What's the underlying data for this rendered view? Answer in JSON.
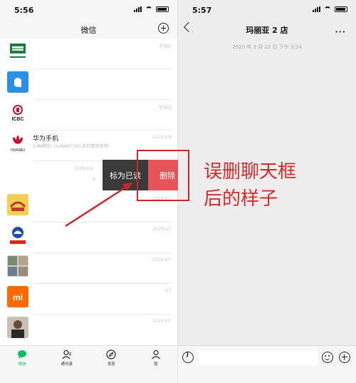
{
  "left_screen": {
    "status_time": "5:56",
    "title": "微信",
    "chats": [
      {
        "name": "",
        "preview": "",
        "date": "星期四"
      },
      {
        "name": "",
        "preview": "",
        "date": ""
      },
      {
        "name": "",
        "preview": "",
        "date": "星期四"
      },
      {
        "name": "华为手机",
        "preview": "价格揭晓！HUAWEI P40 系列重磅亮相！",
        "date": "2020/4/8"
      },
      {
        "name": "",
        "preview": "",
        "date": "2020/4/7"
      },
      {
        "name": "",
        "preview": "",
        "date": "2020/4/5"
      },
      {
        "name": "",
        "preview": "",
        "date": "2020/4/7"
      },
      {
        "name": "",
        "preview": "",
        "date": "4/7"
      },
      {
        "name": "",
        "preview": "",
        "date": "2020/4/7"
      }
    ],
    "swiped_row": {
      "date": "2020/4/8",
      "snippet": "8"
    },
    "swipe_actions": {
      "mark_read": "标为已读",
      "delete": "删除"
    },
    "tabs": [
      {
        "label": "微信",
        "icon": "chat-bubble-icon"
      },
      {
        "label": "通讯录",
        "icon": "contacts-icon"
      },
      {
        "label": "发现",
        "icon": "compass-icon"
      },
      {
        "label": "我",
        "icon": "person-icon"
      }
    ]
  },
  "right_screen": {
    "status_time": "5:57",
    "title": "玛丽亚 2 店",
    "more": "···",
    "chat_timestamp": "2020 年 3 月 22 日  下午 3:34"
  },
  "annotation": {
    "line1": "误删聊天框",
    "line2": "后的样子",
    "color": "#d42b2b"
  },
  "colors": {
    "accent_green": "#07c160",
    "delete_red": "#e6545a",
    "highlight": "#c8282a"
  }
}
